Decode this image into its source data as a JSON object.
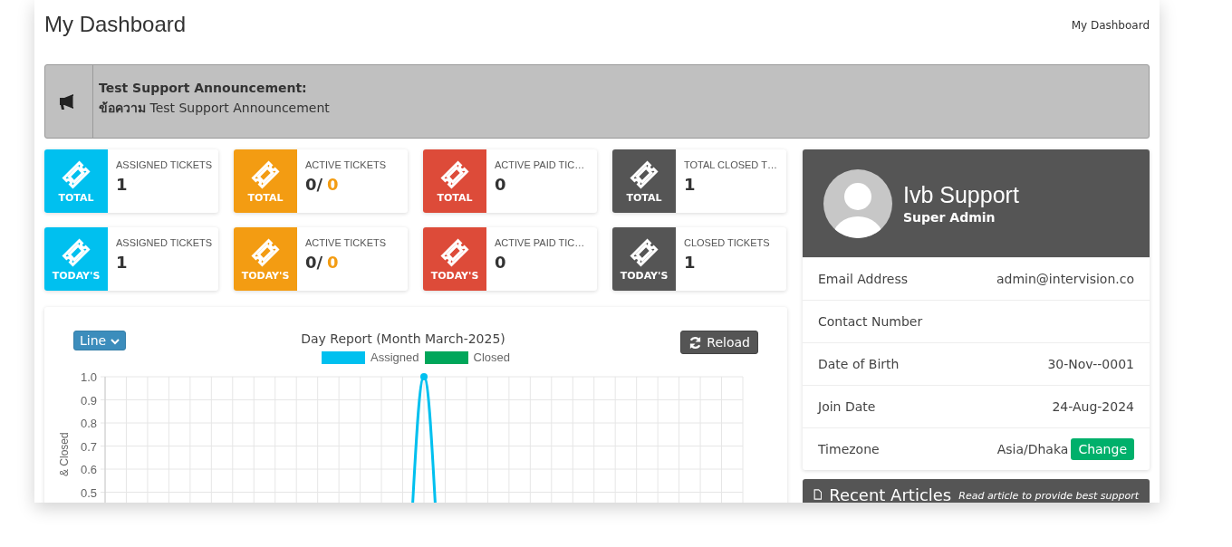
{
  "header": {
    "title": "My Dashboard",
    "breadcrumb": "My Dashboard"
  },
  "announcement": {
    "title": "Test Support Announcement:",
    "prefix": "ข้อความ",
    "text": "Test Support Announcement"
  },
  "stats": [
    {
      "badge": "TOTAL",
      "label": "ASSIGNED TICKETS",
      "value": "1",
      "color": "#00c0ef"
    },
    {
      "badge": "TOTAL",
      "label": "ACTIVE TICKETS",
      "value": "0/",
      "accent": "0",
      "color": "#f39c12"
    },
    {
      "badge": "TOTAL",
      "label": "ACTIVE PAID TIC…",
      "value": "0",
      "color": "#dd4b39"
    },
    {
      "badge": "TOTAL",
      "label": "TOTAL CLOSED T…",
      "value": "1",
      "color": "#555555"
    },
    {
      "badge": "TODAY'S",
      "label": "ASSIGNED TICKETS",
      "value": "1",
      "color": "#00c0ef"
    },
    {
      "badge": "TODAY'S",
      "label": "ACTIVE TICKETS",
      "value": "0/",
      "accent": "0",
      "color": "#f39c12"
    },
    {
      "badge": "TODAY'S",
      "label": "ACTIVE PAID TIC…",
      "value": "0",
      "color": "#dd4b39"
    },
    {
      "badge": "TODAY'S",
      "label": "CLOSED TICKETS",
      "value": "1",
      "color": "#555555"
    }
  ],
  "chart_panel": {
    "type_select": "Line",
    "reload": "Reload",
    "chart_data": {
      "type": "line",
      "title": "Day Report (Month March-2025)",
      "ylabel": "& Closed",
      "grid": true,
      "legend": "top",
      "ylim": [
        0,
        1
      ],
      "yticks": [
        {
          "value": 0.5,
          "label": "0.5"
        },
        {
          "value": 0.6,
          "label": "0.6"
        },
        {
          "value": 0.7,
          "label": "0.7"
        },
        {
          "value": 0.8,
          "label": "0.8"
        },
        {
          "value": 0.9,
          "label": "0.9"
        },
        {
          "value": 1,
          "label": "1.0"
        }
      ],
      "series": [
        {
          "name": "Assigned",
          "color": "#00c0ef",
          "marker": "circle",
          "values": [
            null,
            null,
            null,
            null,
            null,
            null,
            null,
            null,
            null,
            null,
            null,
            null,
            null,
            null,
            0,
            1,
            0,
            null,
            null,
            null,
            null,
            null,
            null,
            null,
            null,
            null,
            null,
            null,
            null,
            null,
            null
          ]
        },
        {
          "name": "Closed",
          "color": "#00a65a"
        }
      ]
    }
  },
  "profile": {
    "name": "Ivb Support",
    "role": "Super Admin",
    "rows": [
      {
        "label": "Email Address",
        "value": "admin@intervision.co"
      },
      {
        "label": "Contact Number"
      },
      {
        "label": "Date of Birth",
        "value": "30-Nov--0001"
      },
      {
        "label": "Join Date",
        "value": "24-Aug-2024"
      },
      {
        "label": "Timezone",
        "value": "Asia/Dhaka",
        "button": "Change"
      }
    ]
  },
  "articles": {
    "title": "Recent Articles",
    "subtitle": "Read article to provide best support"
  }
}
